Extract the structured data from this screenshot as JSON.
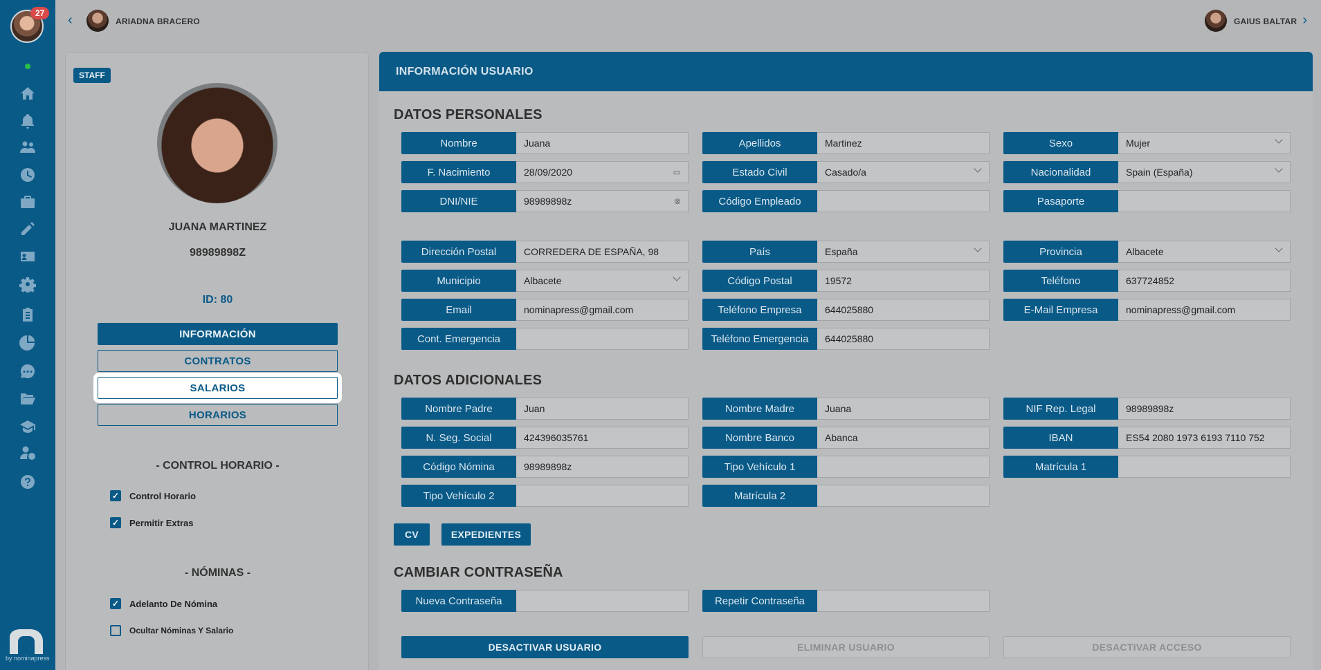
{
  "sidebar": {
    "notifications_badge": "27",
    "icons": [
      "home-icon",
      "bell-icon",
      "users-icon",
      "clock-icon",
      "briefcase-icon",
      "edit-icon",
      "id-card-icon",
      "gear-icon",
      "clipboard-icon",
      "pie-chart-icon",
      "chat-icon",
      "folder-icon",
      "graduation-cap-icon",
      "user-money-icon",
      "help-icon"
    ],
    "brand_by": "by nominapress",
    "accent_color": "#0a5a87"
  },
  "topbar": {
    "prev_user": "ARIADNA BRACERO",
    "next_user": "GAIUS BALTAR"
  },
  "profile": {
    "badge": "STAFF",
    "name": "JUANA MARTINEZ",
    "dni": "98989898Z",
    "id_label": "ID: 80",
    "buttons": {
      "info": "INFORMACIÓN",
      "contracts": "CONTRATOS",
      "salaries": "SALARIOS",
      "schedules": "HORARIOS"
    },
    "control_title": "- CONTROL HORARIO -",
    "control_horario": "Control Horario",
    "permitir_extras": "Permitir Extras",
    "nominas_title": "- NÓMINAS -",
    "adelanto": "Adelanto De Nómina",
    "ocultar": "Ocultar Nóminas Y Salario"
  },
  "main": {
    "header": "INFORMACIÓN USUARIO",
    "personal_title": "DATOS PERSONALES",
    "additional_title": "DATOS ADICIONALES",
    "password_title": "CAMBIAR CONTRASEÑA",
    "fields": {
      "nombre": {
        "label": "Nombre",
        "value": "Juana"
      },
      "apellidos": {
        "label": "Apellidos",
        "value": "Martinez"
      },
      "sexo": {
        "label": "Sexo",
        "value": "Mujer"
      },
      "nacimiento": {
        "label": "F. Nacimiento",
        "value": "28/09/2020"
      },
      "estado_civil": {
        "label": "Estado Civil",
        "value": "Casado/a"
      },
      "nacionalidad": {
        "label": "Nacionalidad",
        "value": "Spain (España)"
      },
      "dni": {
        "label": "DNI/NIE",
        "value": "98989898z"
      },
      "codigo_empleado": {
        "label": "Código Empleado",
        "value": ""
      },
      "pasaporte": {
        "label": "Pasaporte",
        "value": ""
      },
      "direccion": {
        "label": "Dirección Postal",
        "value": "CORREDERA DE ESPAÑA, 98"
      },
      "pais": {
        "label": "País",
        "value": "España"
      },
      "provincia": {
        "label": "Provincia",
        "value": "Albacete"
      },
      "municipio": {
        "label": "Municipio",
        "value": "Albacete"
      },
      "codigo_postal": {
        "label": "Código Postal",
        "value": "19572"
      },
      "telefono": {
        "label": "Teléfono",
        "value": "637724852"
      },
      "email": {
        "label": "Email",
        "value": "nominapress@gmail.com"
      },
      "telefono_empresa": {
        "label": "Teléfono Empresa",
        "value": "644025880"
      },
      "email_empresa": {
        "label": "E-Mail Empresa",
        "value": "nominapress@gmail.com"
      },
      "cont_emergencia": {
        "label": "Cont. Emergencia",
        "value": ""
      },
      "telefono_emergencia": {
        "label": "Teléfono Emergencia",
        "value": "644025880"
      },
      "nombre_padre": {
        "label": "Nombre Padre",
        "value": "Juan"
      },
      "nombre_madre": {
        "label": "Nombre Madre",
        "value": "Juana"
      },
      "nif_rep": {
        "label": "NIF Rep. Legal",
        "value": "98989898z"
      },
      "seg_social": {
        "label": "N. Seg. Social",
        "value": "424396035761"
      },
      "nombre_banco": {
        "label": "Nombre Banco",
        "value": "Abanca"
      },
      "iban": {
        "label": "IBAN",
        "value": "ES54 2080 1973 6193 7110 752"
      },
      "codigo_nomina": {
        "label": "Código Nómina",
        "value": "98989898z"
      },
      "tipo_vehiculo1": {
        "label": "Tipo Vehículo 1",
        "value": ""
      },
      "matricula1": {
        "label": "Matrícula 1",
        "value": ""
      },
      "tipo_vehiculo2": {
        "label": "Tipo Vehículo 2",
        "value": ""
      },
      "matricula2": {
        "label": "Matrícula 2",
        "value": ""
      },
      "nueva_pass": {
        "label": "Nueva Contraseña",
        "value": ""
      },
      "repetir_pass": {
        "label": "Repetir Contraseña",
        "value": ""
      }
    },
    "cv_button": "CV",
    "expedientes_button": "EXPEDIENTES",
    "deactivate_user": "DESACTIVAR USUARIO",
    "delete_user": "ELIMINAR USUARIO",
    "deactivate_access": "DESACTIVAR ACCESO"
  }
}
